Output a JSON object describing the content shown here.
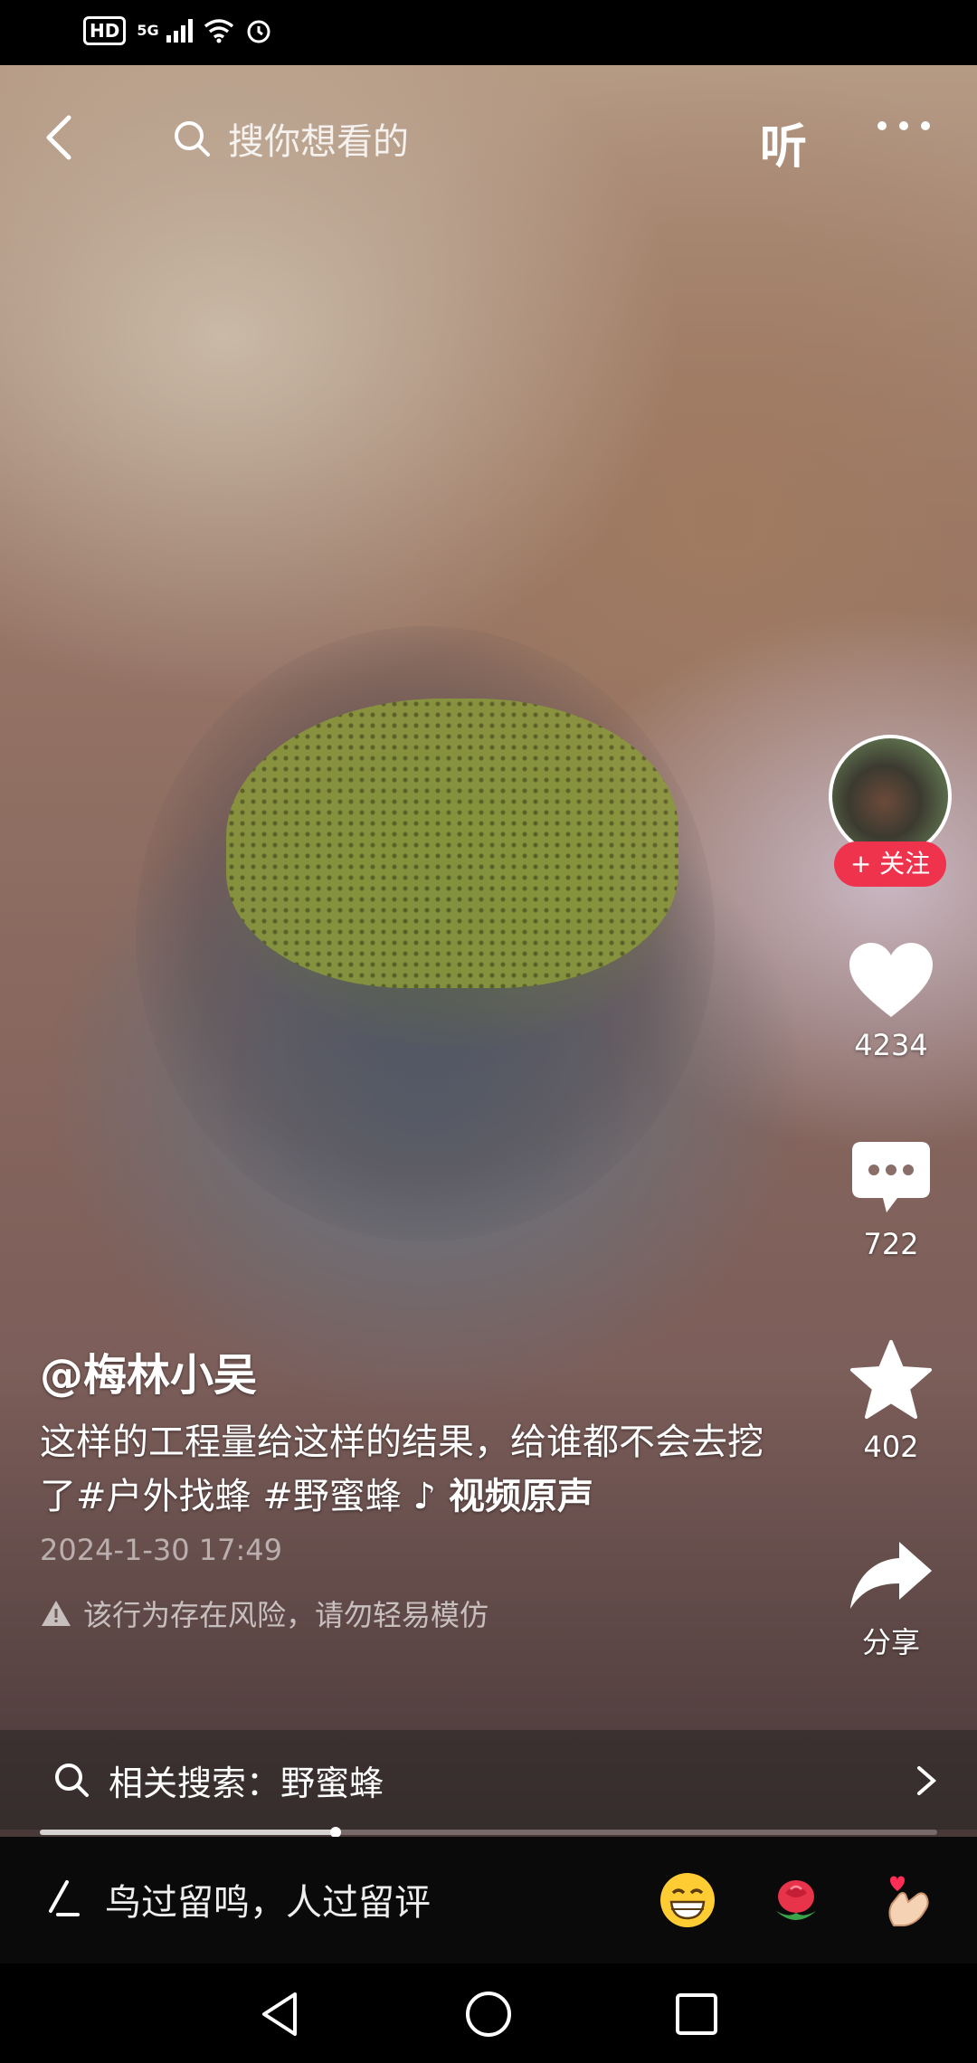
{
  "status_bar": {
    "hd": "HD",
    "network": "5G"
  },
  "top_bar": {
    "search_placeholder": "搜你想看的",
    "listen_label": "听"
  },
  "author": {
    "handle": "@梅林小吴",
    "follow_label": "+ 关注"
  },
  "actions": {
    "likes": "4234",
    "comments": "722",
    "favorites": "402",
    "share_label": "分享"
  },
  "caption": {
    "text": "这样的工程量给这样的结果，给谁都不会去挖了#户外找蜂 #野蜜蜂",
    "music": "♪ 视频原声",
    "date": "2024-1-30 17:49",
    "warning": "该行为存在风险，请勿轻易模仿"
  },
  "related_search": {
    "label": "相关搜索：野蜜蜂"
  },
  "playback": {
    "progress": 0.33
  },
  "comment_bar": {
    "placeholder": "鸟过留鸣，人过留评"
  },
  "colors": {
    "follow": "#f0334d",
    "background": "#000000"
  },
  "icons": [
    "back-icon",
    "search-icon",
    "more-icon",
    "heart-icon",
    "comment-icon",
    "star-icon",
    "share-icon",
    "warning-icon",
    "chevron-right-icon",
    "pen-icon",
    "grin-emoji-icon",
    "rose-emoji-icon",
    "finger-heart-emoji-icon"
  ]
}
